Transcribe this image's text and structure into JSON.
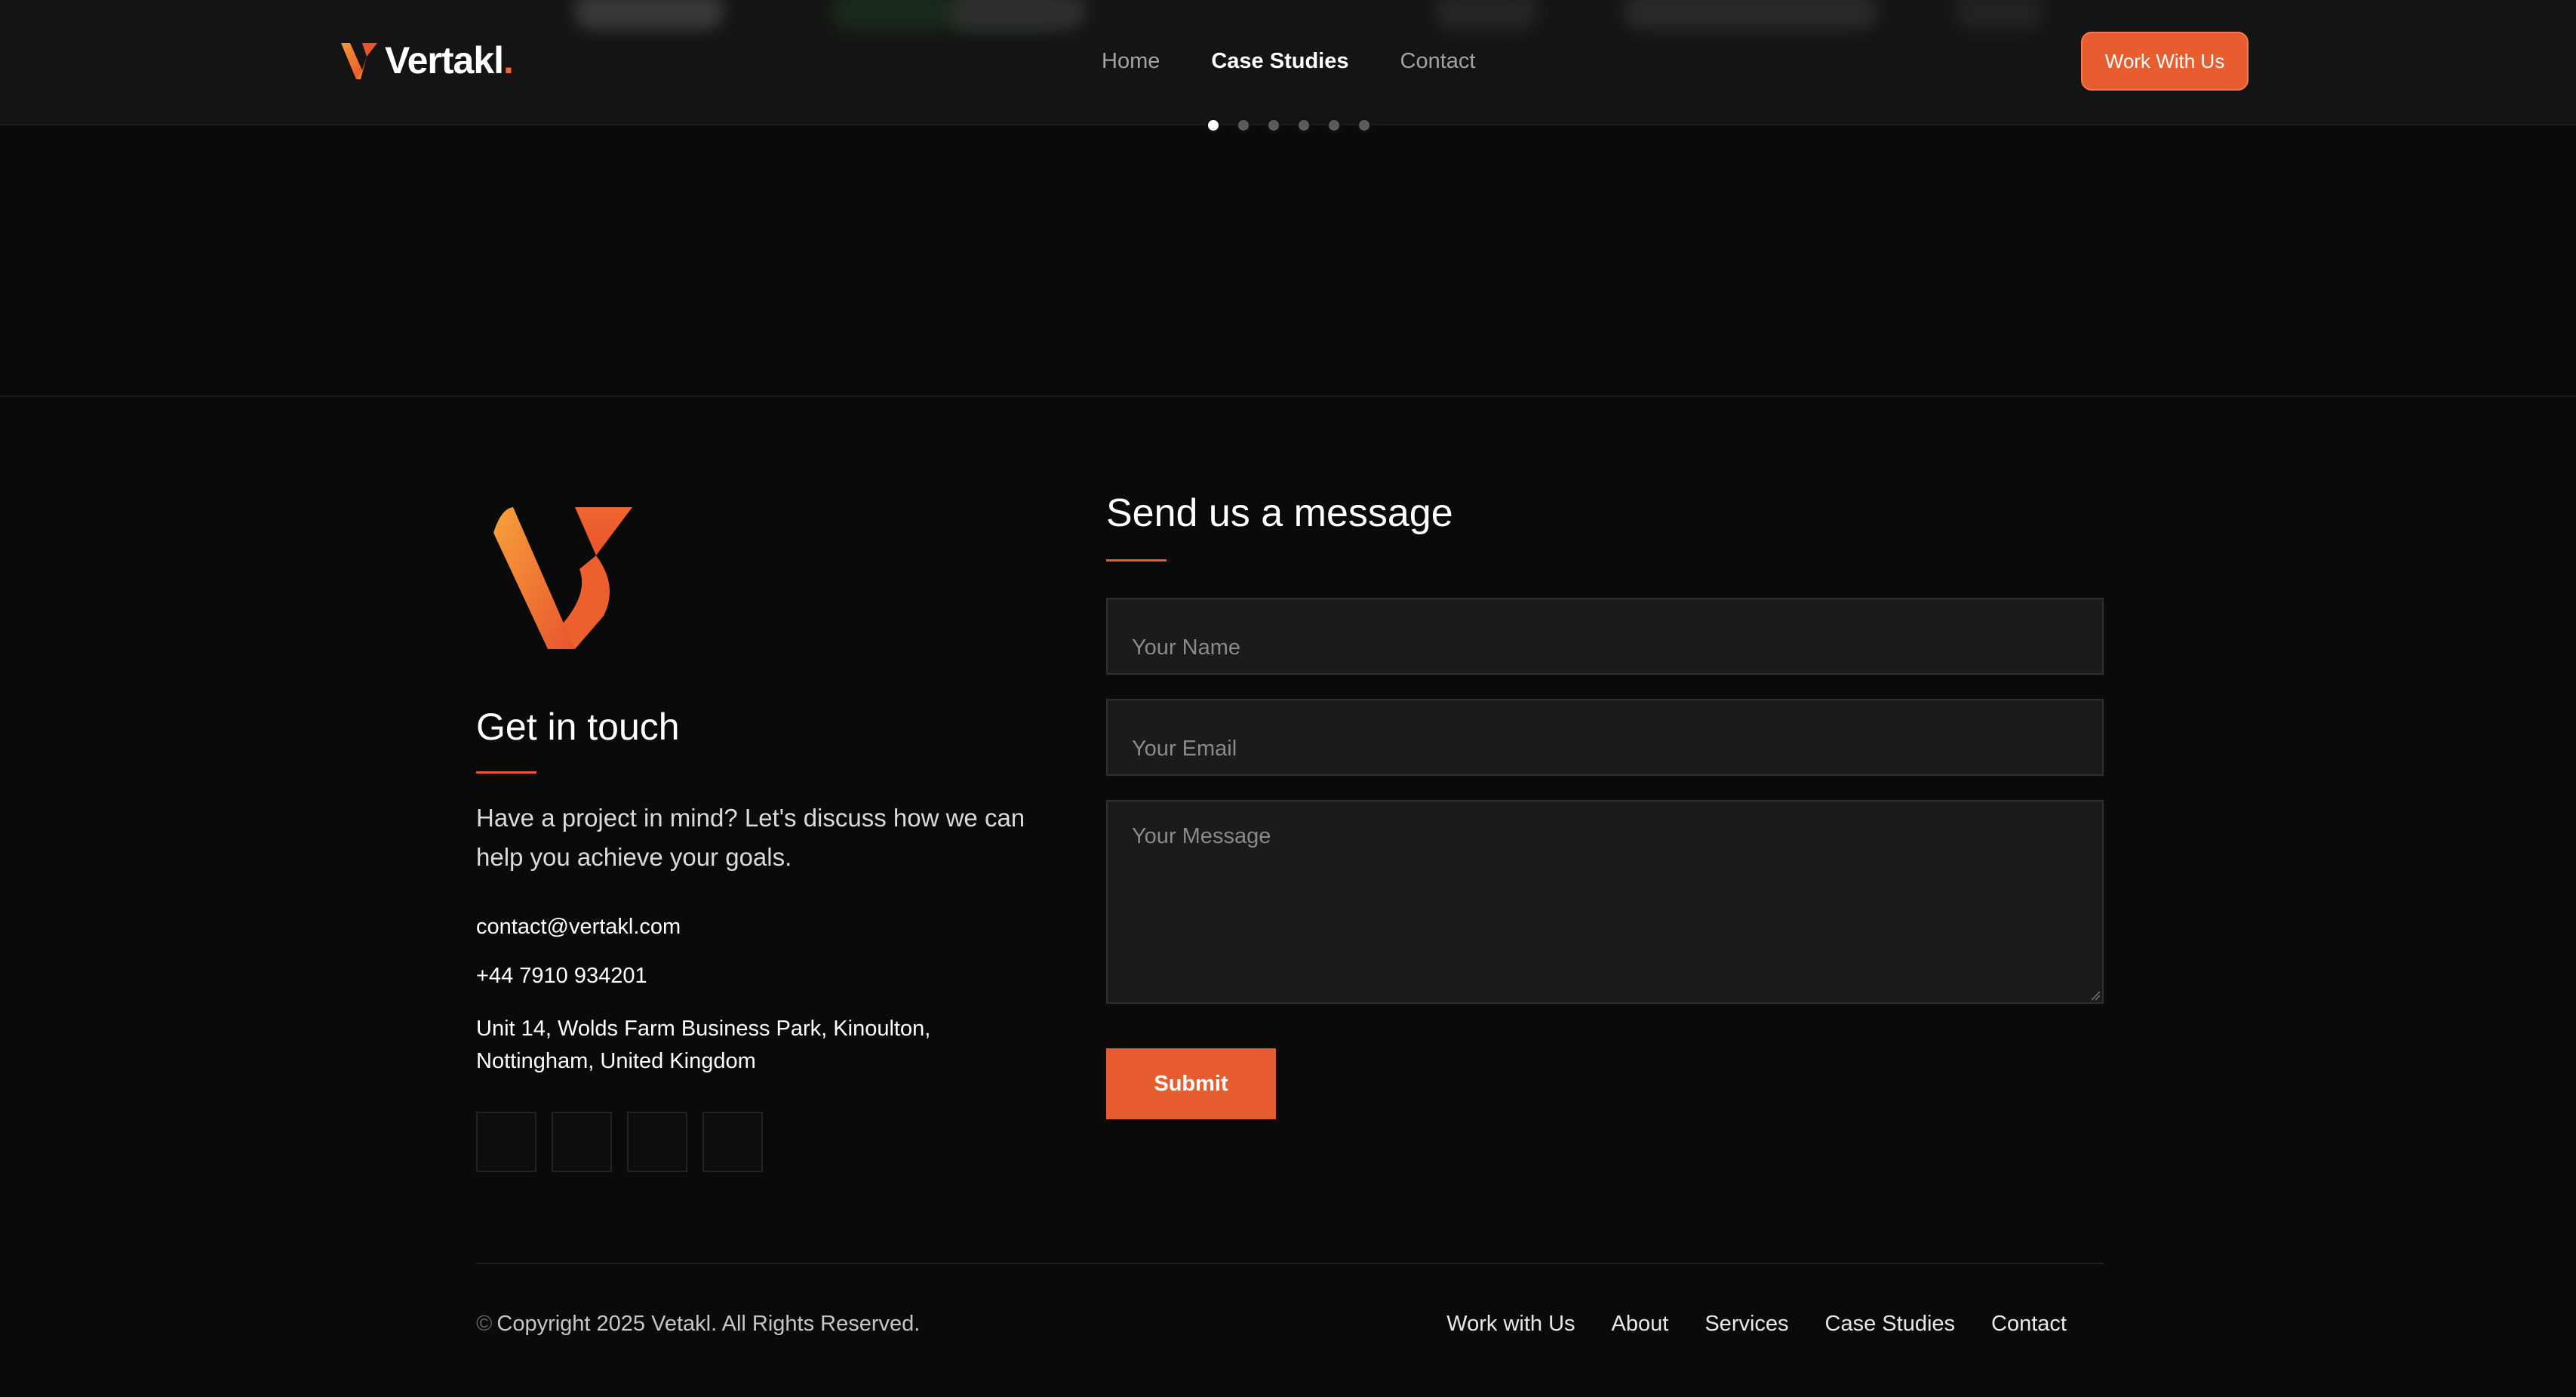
{
  "header": {
    "logo_text": "Vertakl",
    "logo_dot": ".",
    "nav": [
      {
        "label": "Home",
        "active": false
      },
      {
        "label": "Case Studies",
        "active": true
      },
      {
        "label": "Contact",
        "active": false
      }
    ],
    "cta_label": "Work With Us"
  },
  "carousel": {
    "dot_count": 6,
    "active_index": 0
  },
  "contact": {
    "title": "Get in touch",
    "description": "Have a project in mind? Let's discuss how we can help you achieve your goals.",
    "email": "contact@vertakl.com",
    "phone": "+44 7910 934201",
    "address": "Unit 14, Wolds Farm Business Park, Kinoulton, Nottingham, United Kingdom",
    "social_count": 4
  },
  "form": {
    "title": "Send us a message",
    "name_placeholder": "Your Name",
    "email_placeholder": "Your Email",
    "message_placeholder": "Your Message",
    "submit_label": "Submit"
  },
  "footer": {
    "copyright_symbol": "©",
    "copyright": "Copyright 2025 Vetakl. All Rights Reserved.",
    "links": [
      "Work with Us",
      "About",
      "Services",
      "Case Studies",
      "Contact"
    ]
  },
  "colors": {
    "accent": "#e85d30",
    "background": "#0a0a0a",
    "header_bg": "#141414",
    "field_bg": "#1b1b1d"
  }
}
